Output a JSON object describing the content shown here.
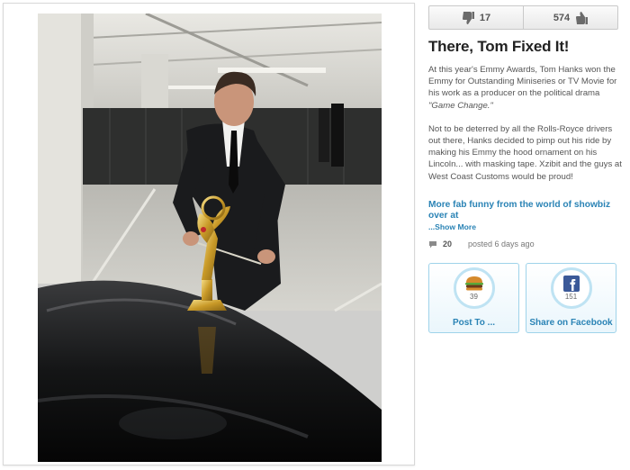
{
  "photo": {
    "alt": "Tom Hanks taping an Emmy statue to the hood of a black car in a parking garage"
  },
  "votes": {
    "down_count": "17",
    "up_count": "574"
  },
  "article": {
    "title": "There, Tom Fixed It!",
    "p1_text": "At this year's Emmy Awards, Tom Hanks won the Emmy for Outstanding Miniseries or TV Movie for his work as a producer on the political drama ",
    "p1_italic": "\"Game Change.\"",
    "p2_text": "Not to be deterred by all the Rolls-Royce drivers out there, Hanks decided to pimp out his ride by making his Emmy the hood ornament on his Lincoln... with masking tape. Xzibit and the guys at West Coast Customs would be proud!",
    "more_link": "More fab funny from the world of showbiz over at",
    "show_more": "...Show More"
  },
  "meta": {
    "comment_count": "20",
    "posted": "posted 6 days ago"
  },
  "share": {
    "post_count": "39",
    "post_label": "Post To ...",
    "fb_count": "151",
    "fb_label": "Share on Facebook"
  },
  "colors": {
    "link": "#2a83b5",
    "card_border": "#9fd3ea"
  },
  "icons": [
    "thumbs-down-icon",
    "thumbs-up-icon",
    "comment-bubble-icon",
    "burger-icon",
    "facebook-icon"
  ]
}
